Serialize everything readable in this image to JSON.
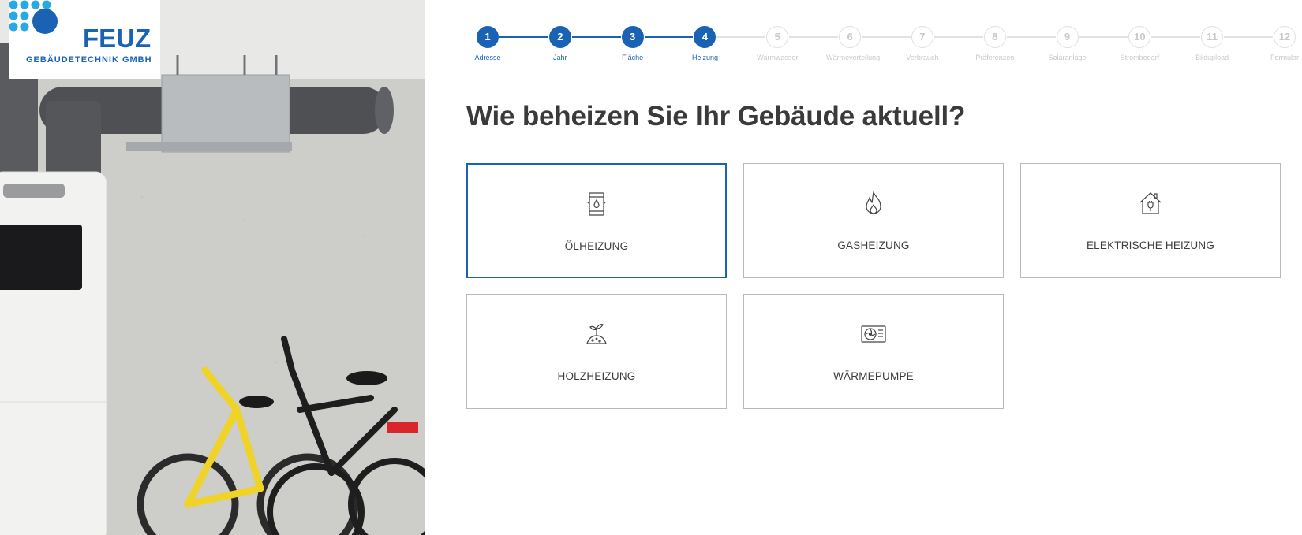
{
  "brand": {
    "name": "FEUZ",
    "subtitle": "GEBÄUDETECHNIK   GMBH",
    "color": "#1a63b4",
    "dot_color": "#29a9e1"
  },
  "stepper": {
    "current_step": 4,
    "steps": [
      {
        "number": "1",
        "label": "Adresse"
      },
      {
        "number": "2",
        "label": "Jahr"
      },
      {
        "number": "3",
        "label": "Fläche"
      },
      {
        "number": "4",
        "label": "Heizung"
      },
      {
        "number": "5",
        "label": "Warmwasser"
      },
      {
        "number": "6",
        "label": "Wärmeverteilung"
      },
      {
        "number": "7",
        "label": "Verbrauch"
      },
      {
        "number": "8",
        "label": "Präferenzen"
      },
      {
        "number": "9",
        "label": "Solaranlage"
      },
      {
        "number": "10",
        "label": "Strombedarf"
      },
      {
        "number": "11",
        "label": "Bildupload"
      },
      {
        "number": "12",
        "label": "Formular"
      }
    ]
  },
  "question": "Wie beheizen Sie Ihr Gebäude aktuell?",
  "options": [
    {
      "label": "ÖLHEIZUNG",
      "icon": "oil-barrel-icon",
      "selected": true
    },
    {
      "label": "GASHEIZUNG",
      "icon": "flame-icon",
      "selected": false
    },
    {
      "label": "ELEKTRISCHE HEIZUNG",
      "icon": "electric-house-icon",
      "selected": false
    },
    {
      "label": "HOLZHEIZUNG",
      "icon": "wood-plant-icon",
      "selected": false
    },
    {
      "label": "WÄRMEPUMPE",
      "icon": "heat-pump-icon",
      "selected": false
    }
  ],
  "colors": {
    "accent": "#1a63b4",
    "inactive": "#c8c8c8",
    "border": "#b9b9b9",
    "heading": "#3a3a3a"
  }
}
